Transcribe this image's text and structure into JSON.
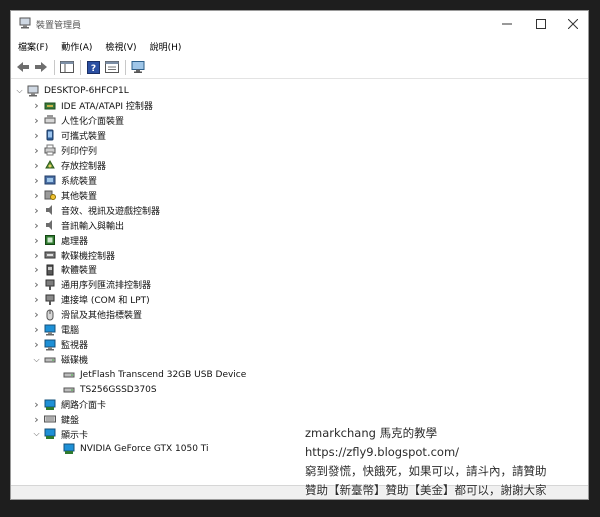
{
  "window": {
    "title": "裝置管理員"
  },
  "menu": [
    {
      "label": "檔案(F)"
    },
    {
      "label": "動作(A)"
    },
    {
      "label": "檢視(V)"
    },
    {
      "label": "說明(H)"
    }
  ],
  "toolbar": [
    {
      "name": "back-button",
      "icon": "arrow-left-icon"
    },
    {
      "name": "forward-button",
      "icon": "arrow-right-icon"
    },
    {
      "name": "console-tree-button",
      "icon": "console-icon"
    },
    {
      "name": "help-button",
      "icon": "help-icon"
    },
    {
      "name": "properties-button",
      "icon": "properties-icon"
    },
    {
      "name": "scan-hardware-button",
      "icon": "monitor-scan-icon"
    }
  ],
  "tree": {
    "root": "DESKTOP-6HFCP1L",
    "items": [
      {
        "label": "IDE ATA/ATAPI 控制器",
        "icon": "ide-icon",
        "expanded": false,
        "level": 1
      },
      {
        "label": "人性化介面裝置",
        "icon": "hid-icon",
        "expanded": false,
        "level": 1
      },
      {
        "label": "可攜式裝置",
        "icon": "portable-device-icon",
        "expanded": false,
        "level": 1
      },
      {
        "label": "列印佇列",
        "icon": "printer-icon",
        "expanded": false,
        "level": 1
      },
      {
        "label": "存放控制器",
        "icon": "storage-controller-icon",
        "expanded": false,
        "level": 1
      },
      {
        "label": "系統裝置",
        "icon": "system-device-icon",
        "expanded": false,
        "level": 1
      },
      {
        "label": "其他裝置",
        "icon": "other-device-icon",
        "expanded": false,
        "level": 1
      },
      {
        "label": "音效、視訊及遊戲控制器",
        "icon": "speaker-icon",
        "expanded": false,
        "level": 1
      },
      {
        "label": "音訊輸入與輸出",
        "icon": "audio-io-icon",
        "expanded": false,
        "level": 1
      },
      {
        "label": "處理器",
        "icon": "processor-icon",
        "expanded": false,
        "level": 1
      },
      {
        "label": "軟碟機控制器",
        "icon": "floppy-controller-icon",
        "expanded": false,
        "level": 1
      },
      {
        "label": "軟體裝置",
        "icon": "software-device-icon",
        "expanded": false,
        "level": 1
      },
      {
        "label": "通用序列匯流排控制器",
        "icon": "usb-icon",
        "expanded": false,
        "level": 1
      },
      {
        "label": "連接埠 (COM 和 LPT)",
        "icon": "port-icon",
        "expanded": false,
        "level": 1
      },
      {
        "label": "滑鼠及其他指標裝置",
        "icon": "mouse-icon",
        "expanded": false,
        "level": 1
      },
      {
        "label": "電腦",
        "icon": "computer-icon",
        "expanded": false,
        "level": 1
      },
      {
        "label": "監視器",
        "icon": "monitor-icon",
        "expanded": false,
        "level": 1
      },
      {
        "label": "磁碟機",
        "icon": "disk-drive-icon",
        "expanded": true,
        "level": 1
      },
      {
        "label": "JetFlash Transcend 32GB USB Device",
        "icon": "disk-icon",
        "level": 2
      },
      {
        "label": "TS256GSSD370S",
        "icon": "disk-icon",
        "level": 2
      },
      {
        "label": "網路介面卡",
        "icon": "network-adapter-icon",
        "expanded": false,
        "level": 1
      },
      {
        "label": "鍵盤",
        "icon": "keyboard-icon",
        "expanded": false,
        "level": 1
      },
      {
        "label": "顯示卡",
        "icon": "display-adapter-icon",
        "expanded": true,
        "level": 1
      },
      {
        "label": "NVIDIA GeForce GTX 1050 Ti",
        "icon": "gpu-icon",
        "level": 2
      }
    ]
  },
  "overlay": {
    "line1": "zmarkchang 馬克的教學",
    "line2": "https://zfly9.blogspot.com/",
    "line3": "窮到發慌，快餓死，如果可以，請斗內，請贊助",
    "line4": "贊助【新臺幣】贊助【美金】都可以，謝謝大家"
  }
}
